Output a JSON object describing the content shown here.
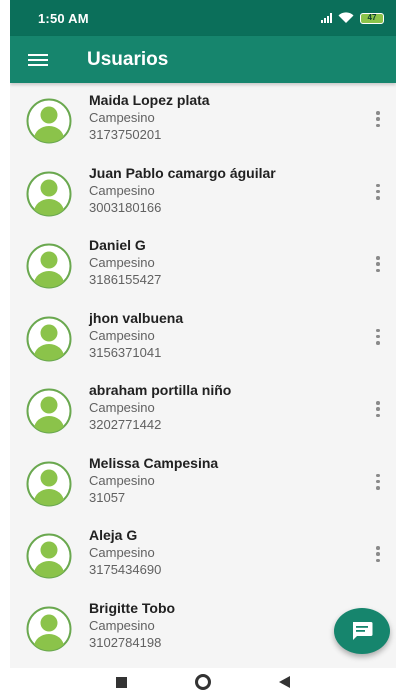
{
  "status_bar": {
    "time": "1:50 AM",
    "battery": "47"
  },
  "app_bar": {
    "title": "Usuarios",
    "menu_icon": "hamburger-menu-icon"
  },
  "users": [
    {
      "name": "Maida Lopez plata",
      "role": "Campesino",
      "phone": "3173750201"
    },
    {
      "name": "Juan Pablo camargo águilar",
      "role": "Campesino",
      "phone": "3003180166"
    },
    {
      "name": "Daniel G",
      "role": "Campesino",
      "phone": "3186155427"
    },
    {
      "name": "jhon valbuena",
      "role": "Campesino",
      "phone": "3156371041"
    },
    {
      "name": "abraham portilla niño",
      "role": "Campesino",
      "phone": "3202771442"
    },
    {
      "name": "Melissa Campesina",
      "role": "Campesino",
      "phone": "31057"
    },
    {
      "name": "Aleja G",
      "role": "Campesino",
      "phone": "3175434690"
    },
    {
      "name": "Brigitte Tobo",
      "role": "Campesino",
      "phone": "3102784198"
    }
  ],
  "fab": {
    "icon": "message-icon"
  },
  "colors": {
    "status_bar": "#0b6f5a",
    "app_bar": "#16856d",
    "avatar": "#8bc34a",
    "accent": "#16856d"
  }
}
